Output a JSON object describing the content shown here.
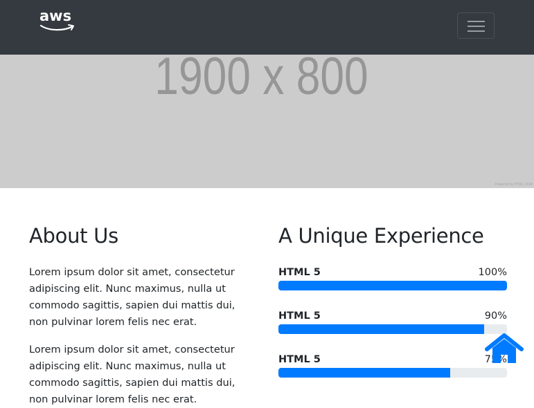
{
  "navbar": {
    "logo_text": "aws",
    "logo_icon": "aws-smile-arrow",
    "menu_icon": "hamburger-menu-icon"
  },
  "hero": {
    "placeholder_text": "1900 x 800",
    "credit": "Powered by HTML.COM"
  },
  "about": {
    "title": "About Us",
    "paragraphs": [
      "Lorem ipsum dolor sit amet, consectetur adipiscing elit. Nunc maximus, nulla ut commodo sagittis, sapien dui mattis dui, non pulvinar lorem felis nec erat.",
      "Lorem ipsum dolor sit amet, consectetur adipiscing elit. Nunc maximus, nulla ut commodo sagittis, sapien dui mattis dui, non pulvinar lorem felis nec erat."
    ]
  },
  "experience": {
    "title": "A Unique Experience",
    "skills": [
      {
        "name": "HTML 5",
        "percent_label": "100%",
        "value": 100
      },
      {
        "name": "HTML 5",
        "percent_label": "90%",
        "value": 90
      },
      {
        "name": "HTML 5",
        "percent_label": "75%",
        "value": 75
      }
    ]
  },
  "floating": {
    "home_icon": "home-icon"
  },
  "colors": {
    "navbar_bg": "#343a40",
    "hero_bg": "#cccccc",
    "accent": "#007bff",
    "track": "#e9ecef"
  }
}
